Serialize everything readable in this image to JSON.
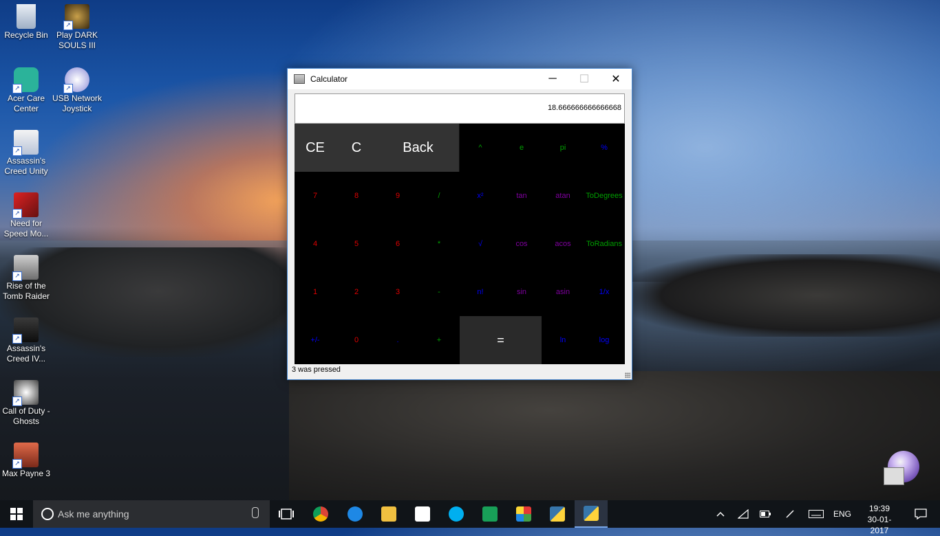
{
  "desktop": {
    "icons": [
      {
        "label": "Recycle Bin"
      },
      {
        "label": "Play DARK SOULS III"
      },
      {
        "label": "Acer Care Center"
      },
      {
        "label": "USB Network Joystick"
      },
      {
        "label": "Assassin's Creed Unity"
      },
      {
        "label": "Need for Speed Mo..."
      },
      {
        "label": "Rise of the Tomb Raider"
      },
      {
        "label": "Assassin's Creed IV..."
      },
      {
        "label": "Call of Duty - Ghosts"
      },
      {
        "label": "Max Payne 3"
      }
    ]
  },
  "window": {
    "title": "Calculator",
    "minimize_glyph": "─",
    "maximize_glyph": "☐",
    "close_glyph": "✕",
    "display_value": "18.666666666666668",
    "status": "3 was pressed"
  },
  "keys": {
    "ce": "CE",
    "c": "C",
    "back": "Back",
    "pow": "^",
    "e": "e",
    "pi": "pi",
    "percent": "%",
    "k7": "7",
    "k8": "8",
    "k9": "9",
    "div": "/",
    "sq": "x²",
    "tan": "tan",
    "atan": "atan",
    "todeg": "ToDegrees",
    "k4": "4",
    "k5": "5",
    "k6": "6",
    "mul": "*",
    "sqrt": "√",
    "cos": "cos",
    "acos": "acos",
    "torad": "ToRadians",
    "k1": "1",
    "k2": "2",
    "k3": "3",
    "sub": "-",
    "fact": "n!",
    "sin": "sin",
    "asin": "asin",
    "inv": "1/x",
    "sign": "+/-",
    "k0": "0",
    "dot": ".",
    "add": "+",
    "eq": "=",
    "ln": "ln",
    "log": "log"
  },
  "taskbar": {
    "search_placeholder": "Ask me anything",
    "language": "ENG",
    "time": "19:39",
    "date": "30-01-2017"
  },
  "colors": {
    "accent": "#4a8bd6",
    "digit_keys": "#e00000",
    "operator_keys": "#00a000",
    "function_keys": "#0000ff",
    "trig_keys": "#8000a0"
  }
}
